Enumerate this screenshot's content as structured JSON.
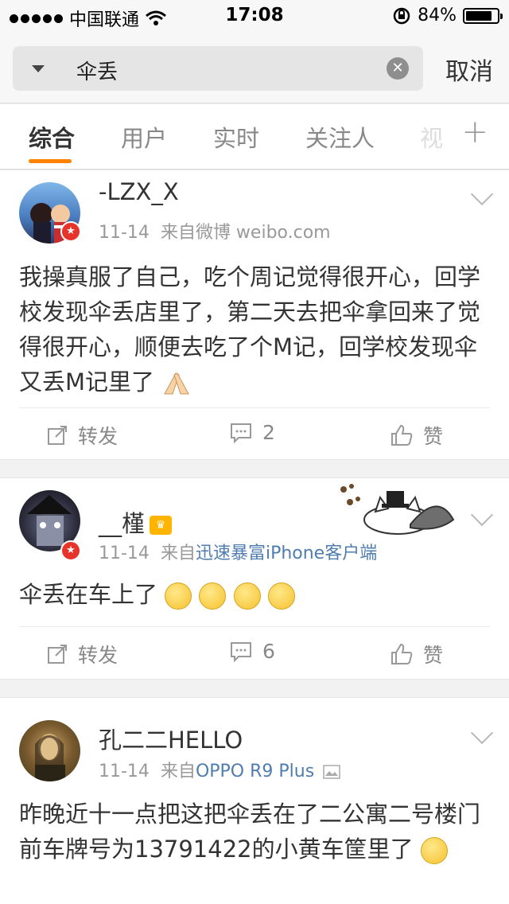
{
  "status": {
    "carrier": "中国联通",
    "time": "17:08",
    "battery": "84%"
  },
  "search": {
    "query": "伞丢",
    "cancel": "取消"
  },
  "tabs": [
    "综合",
    "用户",
    "实时",
    "关注人",
    "视"
  ],
  "posts": [
    {
      "user": "-LZX_X",
      "date": "11-14",
      "source_prefix": "来自微博 weibo.com",
      "source_link": "",
      "content": "我操真服了自己，吃个周记觉得很开心，回学校发现伞丢店里了，第二天去把伞拿回来了觉得很开心，顺便去吃了个M记，回学校发现伞又丢M记里了",
      "repost": "转发",
      "comments": "2",
      "like": "赞"
    },
    {
      "user": "__槿",
      "date": "11-14",
      "source_prefix": "来自",
      "source_link": "迅速暴富iPhone客户端",
      "content": "伞丢在车上了",
      "repost": "转发",
      "comments": "6",
      "like": "赞"
    },
    {
      "user": "孔二二HELLO",
      "date": "11-14",
      "source_prefix": "来自",
      "source_link": "OPPO R9 Plus",
      "content": "昨晚近十一点把这把伞丢在了二公寓二号楼门前车牌号为13791422的小黄车筐里了"
    }
  ]
}
